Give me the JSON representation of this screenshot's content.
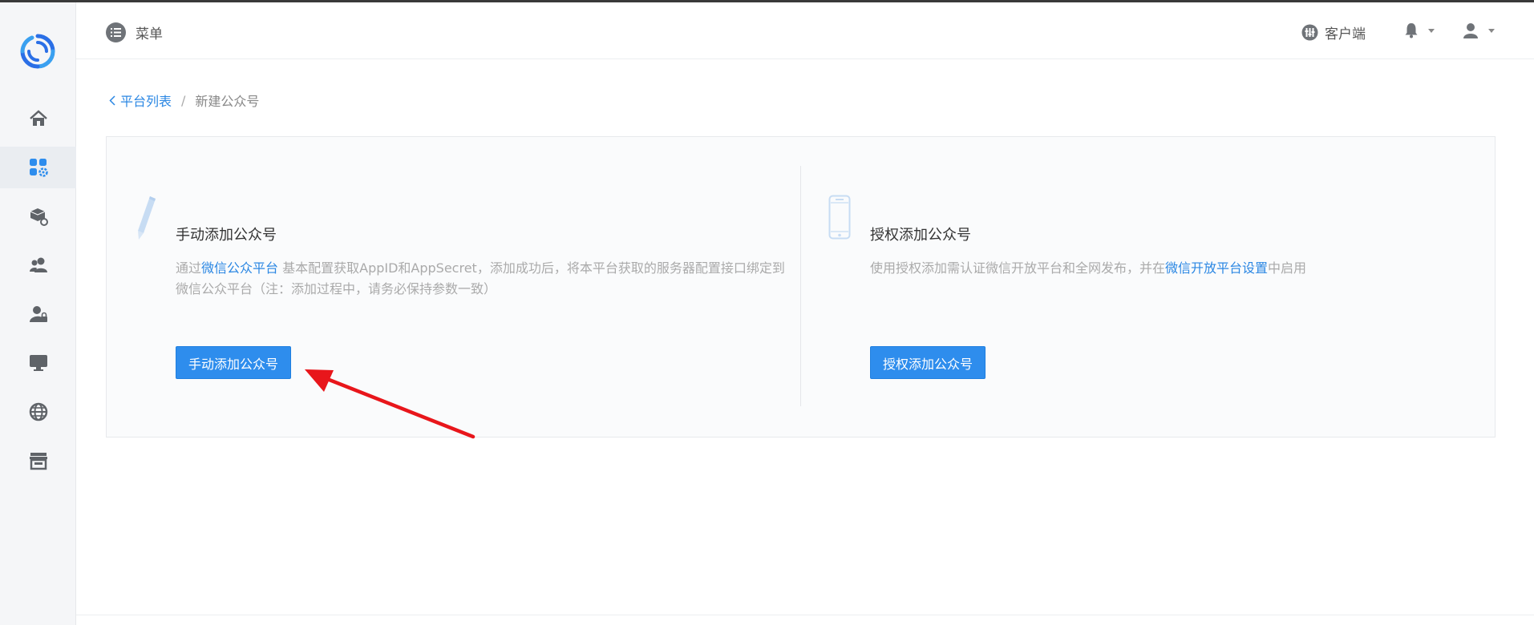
{
  "header": {
    "menu_label": "菜单",
    "client_label": "客户端"
  },
  "sidebar": {
    "items": [
      {
        "icon": "home-icon",
        "active": false
      },
      {
        "icon": "apps-settings-icon",
        "active": true
      },
      {
        "icon": "package-settings-icon",
        "active": false
      },
      {
        "icon": "users-icon",
        "active": false
      },
      {
        "icon": "user-lock-icon",
        "active": false
      },
      {
        "icon": "monitor-icon",
        "active": false
      },
      {
        "icon": "globe-icon",
        "active": false
      },
      {
        "icon": "store-icon",
        "active": false
      }
    ]
  },
  "breadcrumb": {
    "back_label": "平台列表",
    "separator": "/",
    "current": "新建公众号"
  },
  "manual": {
    "title": "手动添加公众号",
    "desc_prefix": "通过",
    "desc_link": "微信公众平台",
    "desc_suffix": " 基本配置获取AppID和AppSecret，添加成功后，将本平台获取的服务器配置接口绑定到微信公众平台（注：添加过程中，请务必保持参数一致）",
    "button_label": "手动添加公众号"
  },
  "auth": {
    "title": "授权添加公众号",
    "desc_prefix": "使用授权添加需认证微信开放平台和全网发布，并在",
    "desc_link": "微信开放平台设置",
    "desc_suffix": "中启用",
    "button_label": "授权添加公众号"
  },
  "colors": {
    "accent": "#2e8ded",
    "link": "#2b87e3",
    "arrow": "#e8161b"
  }
}
